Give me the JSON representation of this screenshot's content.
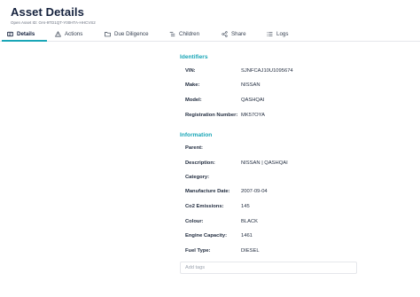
{
  "header": {
    "title": "Asset Details",
    "asset_id": "Open Asset ID: OAI-9TD1QT-Y00HTA-HHCVS2"
  },
  "tabs": [
    {
      "label": "Details",
      "icon": "card-icon",
      "active": true
    },
    {
      "label": "Actions",
      "icon": "warning-triangle-icon",
      "active": false
    },
    {
      "label": "Due Diligence",
      "icon": "folder-icon",
      "active": false
    },
    {
      "label": "Children",
      "icon": "tree-icon",
      "active": false
    },
    {
      "label": "Share",
      "icon": "share-icon",
      "active": false
    },
    {
      "label": "Logs",
      "icon": "list-icon",
      "active": false
    }
  ],
  "identifiers": {
    "title": "Identifiers",
    "rows": [
      {
        "label": "VIN:",
        "value": "SJNFCAJ10U1095674"
      },
      {
        "label": "Make:",
        "value": "NISSAN"
      },
      {
        "label": "Model:",
        "value": "QASHQAI"
      },
      {
        "label": "Registration Number:",
        "value": "MK57OYA"
      }
    ]
  },
  "information": {
    "title": "Information",
    "rows": [
      {
        "label": "Parent:",
        "value": ""
      },
      {
        "label": "Description:",
        "value": "NISSAN | QASHQAI"
      },
      {
        "label": "Category:",
        "value": ""
      },
      {
        "label": "Manufacture Date:",
        "value": "2007-09-04"
      },
      {
        "label": "Co2 Emissions:",
        "value": "145"
      },
      {
        "label": "Colour:",
        "value": "BLACK"
      },
      {
        "label": "Engine Capacity:",
        "value": "1461"
      },
      {
        "label": "Fuel Type:",
        "value": "DIESEL"
      }
    ]
  },
  "tags": {
    "placeholder": "Add tags"
  },
  "colors": {
    "accent": "#1aa6b7",
    "text": "#1f2a3d"
  }
}
